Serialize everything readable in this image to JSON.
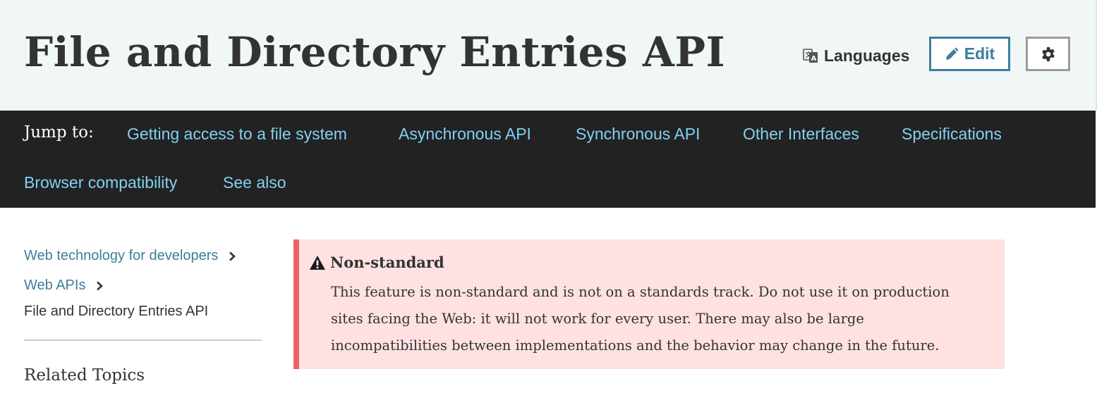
{
  "header": {
    "title": "File and Directory Entries API",
    "languages_label": "Languages",
    "edit_label": "Edit"
  },
  "jump": {
    "label": "Jump to:",
    "links": [
      "Getting access to a file system",
      "Asynchronous API",
      "Synchronous API",
      "Other Interfaces",
      "Specifications",
      "Browser compatibility",
      "See also"
    ]
  },
  "sidebar": {
    "breadcrumbs": [
      "Web technology for developers",
      "Web APIs",
      "File and Directory Entries API"
    ],
    "related_heading": "Related Topics"
  },
  "notice": {
    "title": "Non-standard",
    "lines": [
      "This feature is non-standard and is not on a standards track. Do not use it on production",
      "sites facing the Web: it will not work for every user. There may also be large",
      "incompatibilities between implementations and the behavior may change in the future."
    ]
  },
  "colors": {
    "header_bg": "#f1f7f7",
    "jumpbar_bg": "#222222",
    "jump_link": "#83d0f2",
    "link": "#3d7e9a",
    "notice_bg": "#ffe1e2",
    "notice_border": "#e66465"
  },
  "icons": {
    "languages": "translate-icon",
    "edit": "pencil-icon",
    "settings": "gear-icon",
    "breadcrumb_separator": "chevron-right-icon",
    "notice": "warning-icon"
  }
}
